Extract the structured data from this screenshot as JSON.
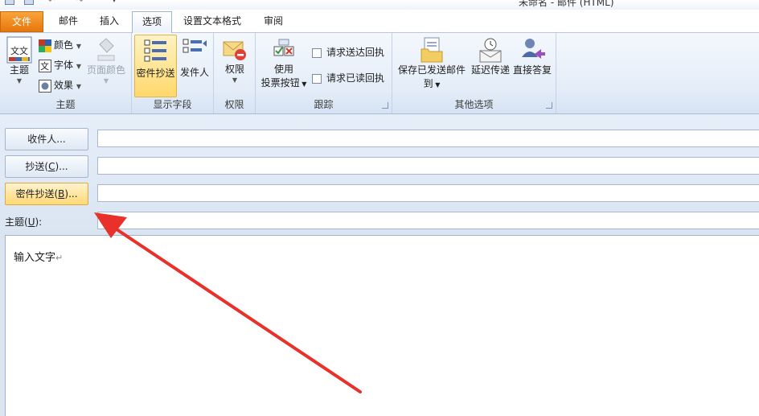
{
  "window": {
    "title": "未命名 - 邮件 (HTML)"
  },
  "tabs": [
    {
      "label": "文件"
    },
    {
      "label": "邮件"
    },
    {
      "label": "插入"
    },
    {
      "label": "选项"
    },
    {
      "label": "设置文本格式"
    },
    {
      "label": "审阅"
    }
  ],
  "ribbon": {
    "theme_group": {
      "label": "主题",
      "theme_button": "主题",
      "colors": "颜色",
      "fonts": "字体",
      "effects": "效果",
      "page_color": "页面颜色",
      "theme_icon_text": "文文"
    },
    "fields_group": {
      "label": "显示字段",
      "bcc": "密件抄送",
      "from": "发件人"
    },
    "permission_group": {
      "label": "权限",
      "permission": "权限"
    },
    "tracking_group": {
      "label": "跟踪",
      "voting_line1": "使用",
      "voting_line2": "投票按钮",
      "delivery_receipt": "请求送达回执",
      "read_receipt": "请求已读回执"
    },
    "more_group": {
      "label": "其他选项",
      "save_sent_line1": "保存已发送邮件",
      "save_sent_line2": "到",
      "delay_delivery": "延迟传递",
      "direct_replies": "直接答复"
    }
  },
  "header": {
    "to_button": "收件人...",
    "cc_button_prefix": "抄送(",
    "cc_button_key": "C",
    "cc_button_suffix": ")...",
    "bcc_button_prefix": "密件抄送(",
    "bcc_button_key": "B",
    "bcc_button_suffix": ")...",
    "subject_prefix": "主题(",
    "subject_key": "U",
    "subject_suffix": "):",
    "to_value": "",
    "cc_value": "",
    "bcc_value": "",
    "subject_value": ""
  },
  "body": {
    "text": "输入文字",
    "paragraph_mark": "↵"
  },
  "colors": {
    "file_tab": "#e8760b",
    "highlight": "#ffd86b",
    "arrow": "#e8312a"
  }
}
